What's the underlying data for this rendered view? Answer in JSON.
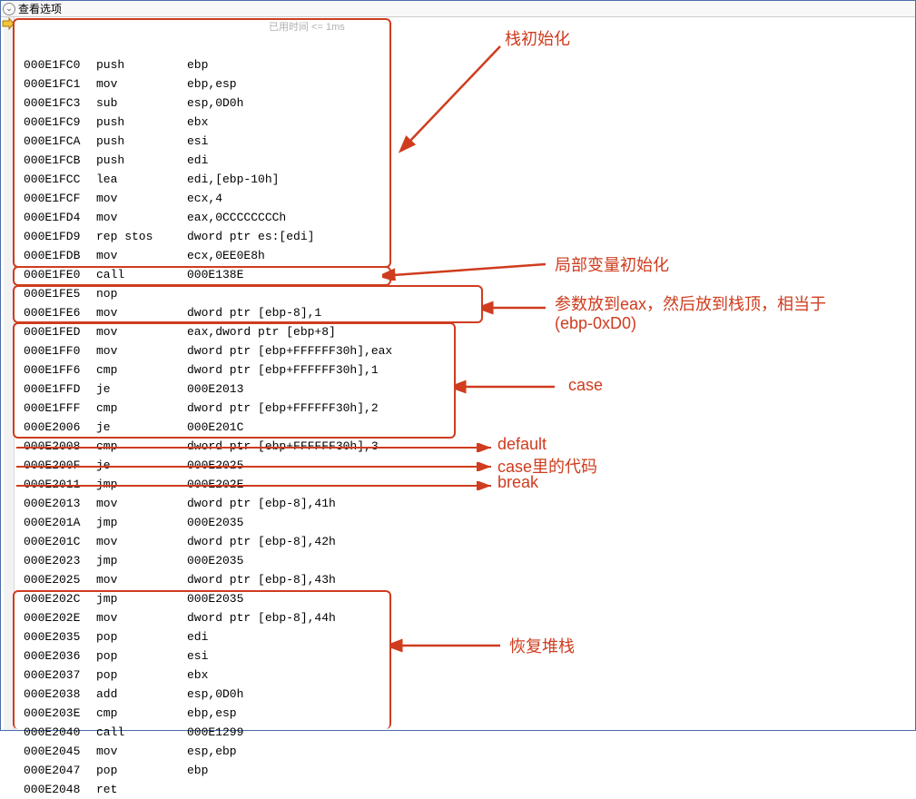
{
  "topbar": {
    "label": "查看选项"
  },
  "timing_text": "已用时间 <= 1ms",
  "rows": [
    {
      "addr": "000E1FC0",
      "mnem": "push",
      "oper": "ebp"
    },
    {
      "addr": "000E1FC1",
      "mnem": "mov",
      "oper": "ebp,esp"
    },
    {
      "addr": "000E1FC3",
      "mnem": "sub",
      "oper": "esp,0D0h"
    },
    {
      "addr": "000E1FC9",
      "mnem": "push",
      "oper": "ebx"
    },
    {
      "addr": "000E1FCA",
      "mnem": "push",
      "oper": "esi"
    },
    {
      "addr": "000E1FCB",
      "mnem": "push",
      "oper": "edi"
    },
    {
      "addr": "000E1FCC",
      "mnem": "lea",
      "oper": "edi,[ebp-10h]"
    },
    {
      "addr": "000E1FCF",
      "mnem": "mov",
      "oper": "ecx,4"
    },
    {
      "addr": "000E1FD4",
      "mnem": "mov",
      "oper": "eax,0CCCCCCCCh"
    },
    {
      "addr": "000E1FD9",
      "mnem": "rep stos",
      "oper": "dword ptr es:[edi]"
    },
    {
      "addr": "000E1FDB",
      "mnem": "mov",
      "oper": "ecx,0EE0E8h"
    },
    {
      "addr": "000E1FE0",
      "mnem": "call",
      "oper": "000E138E"
    },
    {
      "addr": "000E1FE5",
      "mnem": "nop",
      "oper": ""
    },
    {
      "addr": "000E1FE6",
      "mnem": "mov",
      "oper": "dword ptr [ebp-8],1"
    },
    {
      "addr": "000E1FED",
      "mnem": "mov",
      "oper": "eax,dword ptr [ebp+8]"
    },
    {
      "addr": "000E1FF0",
      "mnem": "mov",
      "oper": "dword ptr [ebp+FFFFFF30h],eax"
    },
    {
      "addr": "000E1FF6",
      "mnem": "cmp",
      "oper": "dword ptr [ebp+FFFFFF30h],1"
    },
    {
      "addr": "000E1FFD",
      "mnem": "je",
      "oper": "000E2013"
    },
    {
      "addr": "000E1FFF",
      "mnem": "cmp",
      "oper": "dword ptr [ebp+FFFFFF30h],2"
    },
    {
      "addr": "000E2006",
      "mnem": "je",
      "oper": "000E201C"
    },
    {
      "addr": "000E2008",
      "mnem": "cmp",
      "oper": "dword ptr [ebp+FFFFFF30h],3"
    },
    {
      "addr": "000E200F",
      "mnem": "je",
      "oper": "000E2025"
    },
    {
      "addr": "000E2011",
      "mnem": "jmp",
      "oper": "000E202E"
    },
    {
      "addr": "000E2013",
      "mnem": "mov",
      "oper": "dword ptr [ebp-8],41h"
    },
    {
      "addr": "000E201A",
      "mnem": "jmp",
      "oper": "000E2035"
    },
    {
      "addr": "000E201C",
      "mnem": "mov",
      "oper": "dword ptr [ebp-8],42h"
    },
    {
      "addr": "000E2023",
      "mnem": "jmp",
      "oper": "000E2035"
    },
    {
      "addr": "000E2025",
      "mnem": "mov",
      "oper": "dword ptr [ebp-8],43h"
    },
    {
      "addr": "000E202C",
      "mnem": "jmp",
      "oper": "000E2035"
    },
    {
      "addr": "000E202E",
      "mnem": "mov",
      "oper": "dword ptr [ebp-8],44h"
    },
    {
      "addr": "000E2035",
      "mnem": "pop",
      "oper": "edi"
    },
    {
      "addr": "000E2036",
      "mnem": "pop",
      "oper": "esi"
    },
    {
      "addr": "000E2037",
      "mnem": "pop",
      "oper": "ebx"
    },
    {
      "addr": "000E2038",
      "mnem": "add",
      "oper": "esp,0D0h"
    },
    {
      "addr": "000E203E",
      "mnem": "cmp",
      "oper": "ebp,esp"
    },
    {
      "addr": "000E2040",
      "mnem": "call",
      "oper": "000E1299"
    },
    {
      "addr": "000E2045",
      "mnem": "mov",
      "oper": "esp,ebp"
    },
    {
      "addr": "000E2047",
      "mnem": "pop",
      "oper": "ebp"
    },
    {
      "addr": "000E2048",
      "mnem": "ret",
      "oper": ""
    }
  ],
  "annotations": {
    "stack_init": "栈初始化",
    "local_var_init": "局部变量初始化",
    "param_to_eax_line1": "参数放到eax，然后放到栈顶，相当于",
    "param_to_eax_line2": "(ebp-0xD0)",
    "case": "case",
    "default": "default",
    "case_code": "case里的代码",
    "break": "break",
    "restore_stack": "恢复堆栈"
  }
}
